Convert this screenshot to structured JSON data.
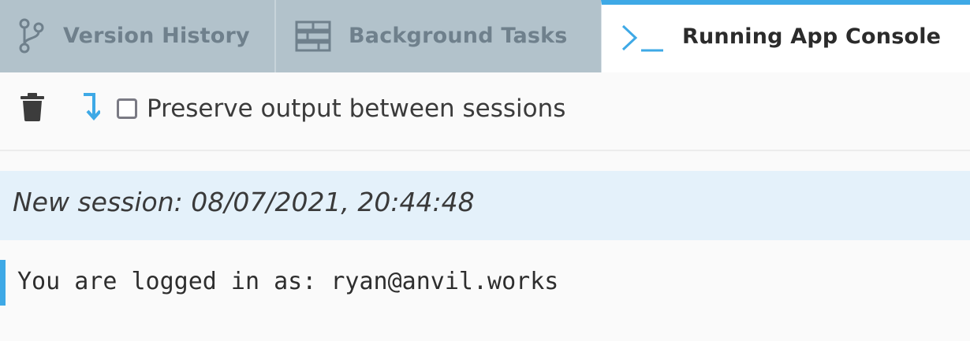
{
  "tabs": [
    {
      "label": "Version History",
      "icon": "branch-icon",
      "active": false
    },
    {
      "label": "Background Tasks",
      "icon": "server-icon",
      "active": false
    },
    {
      "label": "Running App Console",
      "icon": "terminal-icon",
      "active": true
    }
  ],
  "toolbar": {
    "clear_icon": "trash-icon",
    "autoscroll_icon": "scroll-down-arrow-icon",
    "preserve_checked": false,
    "preserve_label": "Preserve output between sessions"
  },
  "console": {
    "session_banner": "New session: 08/07/2021, 20:44:48",
    "lines": [
      "You are logged in as: ryan@anvil.works"
    ]
  },
  "colors": {
    "accent": "#3ea9e6",
    "tabbar_bg": "#b2c2cb",
    "inactive_tab_text": "#6f808c",
    "session_bg": "#e4f1fa"
  }
}
